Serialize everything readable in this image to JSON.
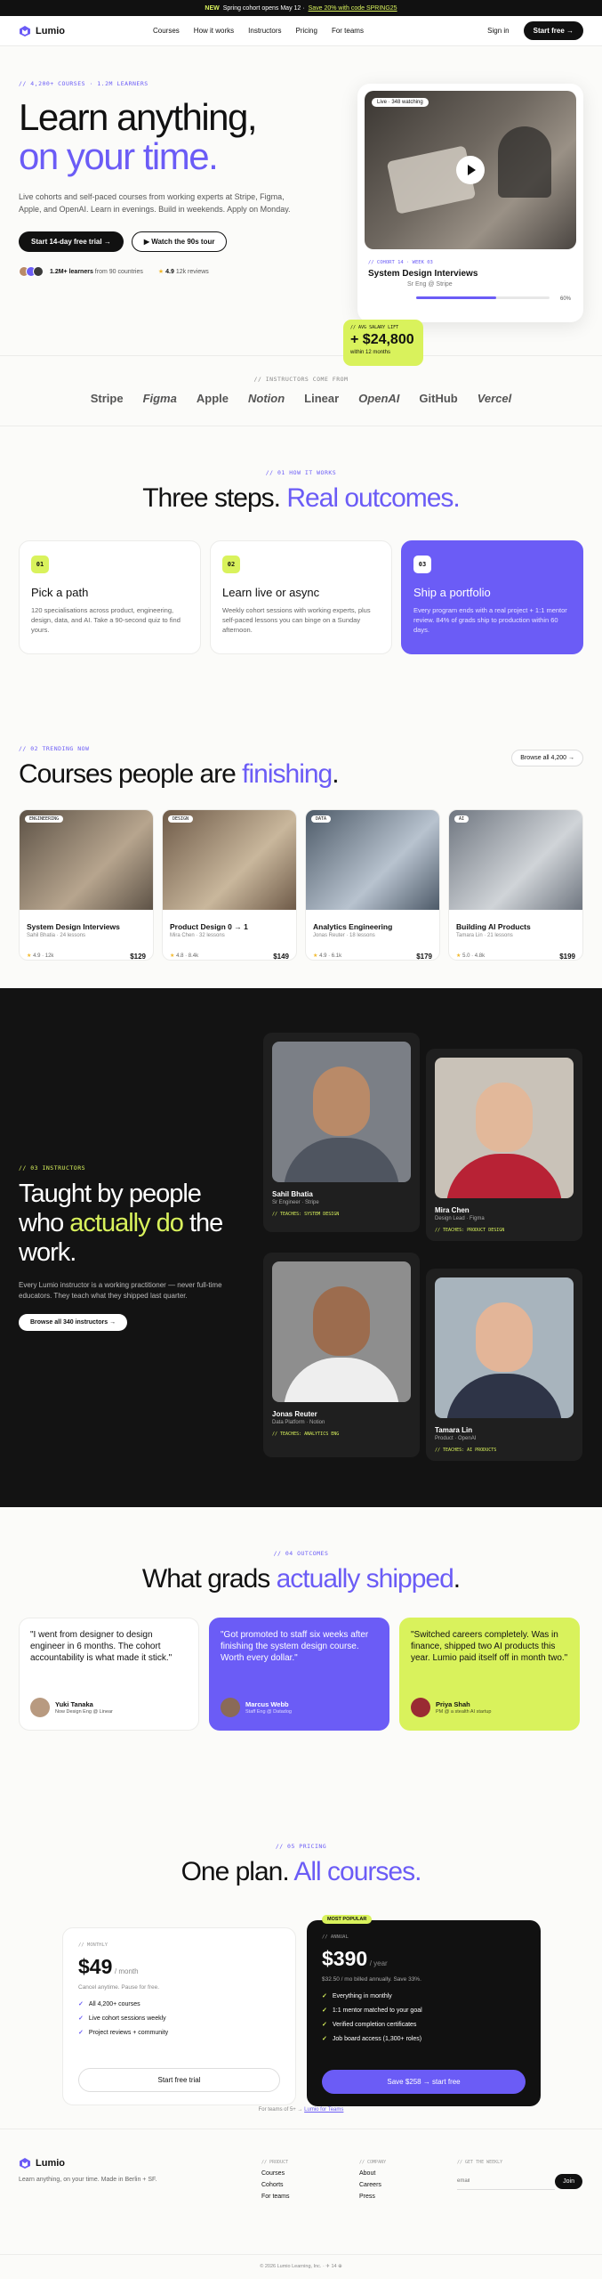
{
  "announcement": {
    "badge": "NEW",
    "text": "Spring cohort opens May 12 ·",
    "promo": "Save 20% with code SPRING25"
  },
  "nav": {
    "brand": "Lumio",
    "links": [
      "Courses",
      "How it works",
      "Instructors",
      "Pricing",
      "For teams"
    ],
    "signin": "Sign in",
    "cta": "Start free →"
  },
  "hero": {
    "eyebrow": "// 4,200+ COURSES · 1.2M LEARNERS",
    "title_line1": "Learn anything,",
    "title_line2": "on your time.",
    "description": "Live cohorts and self-paced courses from working experts at Stripe, Figma, Apple, and OpenAI. Learn in evenings. Build in weekends. Apply on Monday.",
    "primary_cta": "Start 14-day free trial →",
    "secondary_cta": "Watch the 90s tour",
    "learners_count": "1.2M+ learners",
    "learners_suffix": "from 90 countries",
    "rating": "4.9",
    "reviews": "12k reviews",
    "card": {
      "live_pill": "Live · 348 watching",
      "eyebrow": "// COHORT 14 · WEEK 03",
      "title": "System Design Interviews",
      "subtitle": "Sr Eng @ Stripe",
      "progress_pct": "60%",
      "progress": 60
    },
    "salary": {
      "label": "// AVG SALARY LIFT",
      "value": "+ $24,800",
      "sub": "within 12 months"
    }
  },
  "logos": {
    "eyebrow": "// INSTRUCTORS COME FROM",
    "items": [
      {
        "name": "Stripe",
        "italic": false
      },
      {
        "name": "Figma",
        "italic": true
      },
      {
        "name": "Apple",
        "italic": false
      },
      {
        "name": "Notion",
        "italic": true
      },
      {
        "name": "Linear",
        "italic": false
      },
      {
        "name": "OpenAI",
        "italic": true
      },
      {
        "name": "GitHub",
        "italic": false
      },
      {
        "name": "Vercel",
        "italic": true
      }
    ]
  },
  "steps": {
    "eyebrow": "// 01 HOW IT WORKS",
    "title_plain": "Three steps.",
    "title_accent": "Real outcomes.",
    "items": [
      {
        "num": "01",
        "title": "Pick a path",
        "desc": "120 specialisations across product, engineering, design, data, and AI. Take a 90-second quiz to find yours."
      },
      {
        "num": "02",
        "title": "Learn live or async",
        "desc": "Weekly cohort sessions with working experts, plus self-paced lessons you can binge on a Sunday afternoon."
      },
      {
        "num": "03",
        "title": "Ship a portfolio",
        "desc": "Every program ends with a real project + 1:1 mentor review. 84% of grads ship to production within 60 days."
      }
    ]
  },
  "courses": {
    "eyebrow": "// 02 TRENDING NOW",
    "title_plain": "Courses people are",
    "title_accent": "finishing",
    "title_end": ".",
    "browse": "Browse all 4,200 →",
    "items": [
      {
        "tag": "ENGINEERING",
        "title": "System Design Interviews",
        "meta": "Sahil Bhatia · 24 lessons",
        "rating": "4.9 · 12k",
        "price": "$129",
        "c1": "#5d5246",
        "c2": "#b7a58e"
      },
      {
        "tag": "DESIGN",
        "title": "Product Design 0 → 1",
        "meta": "Mira Chen · 32 lessons",
        "rating": "4.8 · 8.4k",
        "price": "$149",
        "c1": "#6e5a48",
        "c2": "#c9b79c"
      },
      {
        "tag": "DATA",
        "title": "Analytics Engineering",
        "meta": "Jonas Reuter · 18 lessons",
        "rating": "4.9 · 6.1k",
        "price": "$179",
        "c1": "#4d5a68",
        "c2": "#b8c3cf"
      },
      {
        "tag": "AI",
        "title": "Building AI Products",
        "meta": "Tamara Lin · 21 lessons",
        "rating": "5.0 · 4.8k",
        "price": "$199",
        "c1": "#6f7680",
        "c2": "#d0d4d8"
      }
    ]
  },
  "instructors": {
    "eyebrow": "// 03 INSTRUCTORS",
    "title_1": "Taught by people",
    "title_2": "who",
    "title_accent": "actually do",
    "title_3": "the",
    "title_4": "work.",
    "description": "Every Lumio instructor is a working practitioner — never full-time educators. They teach what they shipped last quarter.",
    "cta": "Browse all 340 instructors →",
    "people": [
      {
        "name": "Sahil Bhatia",
        "role": "Sr Engineer · Stripe",
        "teaches": "// TEACHES: SYSTEM DESIGN",
        "bg": "#7b7f86",
        "skin": "#b98a68",
        "shirt": "#4f5560"
      },
      {
        "name": "Mira Chen",
        "role": "Design Lead · Figma",
        "teaches": "// TEACHES: PRODUCT DESIGN",
        "bg": "#c9c2b8",
        "skin": "#e2b89a",
        "shirt": "#b82235"
      },
      {
        "name": "Jonas Reuter",
        "role": "Data Platform · Notion",
        "teaches": "// TEACHES: ANALYTICS ENG",
        "bg": "#8e8e8e",
        "skin": "#9c6c4e",
        "shirt": "#eeeeee"
      },
      {
        "name": "Tamara Lin",
        "role": "Product · OpenAI",
        "teaches": "// TEACHES: AI PRODUCTS",
        "bg": "#a8b4bd",
        "skin": "#e3b598",
        "shirt": "#2e3447"
      }
    ]
  },
  "testimonials": {
    "eyebrow": "// 04 OUTCOMES",
    "title_plain": "What grads",
    "title_accent": "actually shipped",
    "title_end": ".",
    "items": [
      {
        "quote": "\"I went from designer to design engineer in 6 months. The cohort accountability is what made it stick.\"",
        "name": "Yuki Tanaka",
        "role": "Now Design Eng @ Linear",
        "av": "#b89a80"
      },
      {
        "quote": "\"Got promoted to staff six weeks after finishing the system design course. Worth every dollar.\"",
        "name": "Marcus Webb",
        "role": "Staff Eng @ Datadog",
        "av": "#8a6a58"
      },
      {
        "quote": "\"Switched careers completely. Was in finance, shipped two AI products this year. Lumio paid itself off in month two.\"",
        "name": "Priya Shah",
        "role": "PM @ a stealth AI startup",
        "av": "#9a2b33"
      }
    ]
  },
  "pricing": {
    "eyebrow": "// 05 PRICING",
    "title_plain": "One plan.",
    "title_accent": "All courses.",
    "monthly": {
      "label": "// MONTHLY",
      "price": "$49",
      "period": "/ month",
      "note": "Cancel anytime. Pause for free.",
      "features": [
        "All 4,200+ courses",
        "Live cohort sessions weekly",
        "Project reviews + community"
      ],
      "cta": "Start free trial"
    },
    "annual": {
      "popular": "MOST POPULAR",
      "label": "// ANNUAL",
      "price": "$390",
      "period": "/ year",
      "note": "$32.50 / mo billed annually. Save 33%.",
      "features": [
        "Everything in monthly",
        "1:1 mentor matched to your goal",
        "Verified completion certificates",
        "Job board access (1,300+ roles)"
      ],
      "cta": "Save $258 → start free"
    },
    "teams_note": "For teams of 5+ →",
    "teams_link": "Lumio for Teams"
  },
  "footer": {
    "brand": "Lumio",
    "tagline": "Learn anything, on your time. Made in Berlin + SF.",
    "product_head": "// PRODUCT",
    "product": [
      "Courses",
      "Cohorts",
      "For teams"
    ],
    "company_head": "// COMPANY",
    "company": [
      "About",
      "Careers",
      "Press"
    ],
    "news_head": "// GET THE WEEKLY",
    "email_placeholder": "email",
    "join": "Join",
    "copyright": "© 2026 Lumio Learning, Inc. · ✈ 14 ⊕"
  },
  "colors": {
    "accent": "#6b5cf6",
    "lime": "#d9f25c",
    "dark": "#131313"
  }
}
